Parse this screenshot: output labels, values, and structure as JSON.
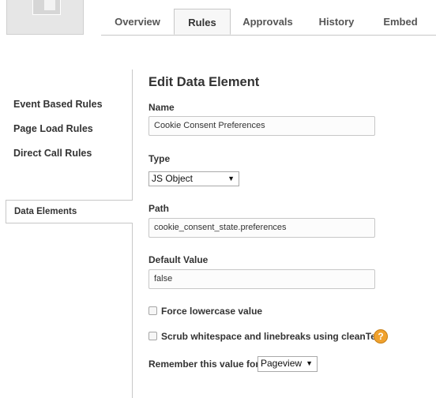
{
  "tabs": [
    {
      "label": "Overview"
    },
    {
      "label": "Rules"
    },
    {
      "label": "Approvals"
    },
    {
      "label": "History"
    },
    {
      "label": "Embed"
    }
  ],
  "active_tab": "Rules",
  "sidebar": {
    "items": [
      {
        "label": "Event Based Rules"
      },
      {
        "label": "Page Load Rules"
      },
      {
        "label": "Direct Call Rules"
      },
      {
        "label": "Data Elements"
      }
    ],
    "active_item": "Data Elements"
  },
  "form": {
    "heading": "Edit Data Element",
    "name_label": "Name",
    "name_value": "Cookie Consent Preferences",
    "type_label": "Type",
    "type_value": "JS Object",
    "path_label": "Path",
    "path_value": "cookie_consent_state.preferences",
    "default_label": "Default Value",
    "default_value": "false",
    "lowercase_label": "Force lowercase value",
    "lowercase_checked": false,
    "scrub_label": "Scrub whitespace and linebreaks using cleanText",
    "scrub_checked": false,
    "help_icon_text": "?",
    "remember_label": "Remember this value for",
    "remember_value": "Pageview"
  },
  "colors": {
    "border": "#c7c7c7",
    "help_icon": "#f0a22e",
    "active_tab_bg": "#f7f7f7"
  }
}
